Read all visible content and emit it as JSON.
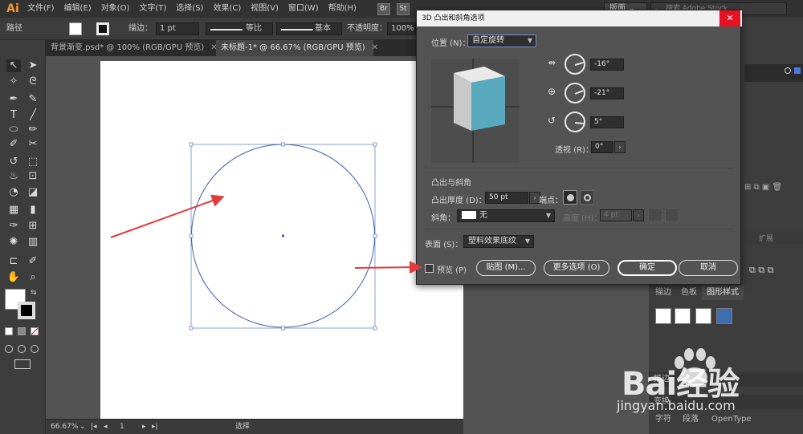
{
  "app": {
    "logo": "Ai"
  },
  "menubar": {
    "items": [
      "文件(F)",
      "编辑(E)",
      "对象(O)",
      "文字(T)",
      "选择(S)",
      "效果(C)",
      "视图(V)",
      "窗口(W)",
      "帮助(H)"
    ],
    "bridge_label": "Br",
    "stock_label": "St",
    "workspace": "版面",
    "search_placeholder": "搜索 Adobe Stock"
  },
  "controlbar": {
    "object_type": "路径",
    "stroke_label": "描边：",
    "stroke_weight": "1 pt",
    "profile_label": "等比",
    "brush_label": "基本",
    "opacity_label": "不透明度：",
    "opacity_value": "100%"
  },
  "tabs": [
    {
      "label": "背景渐变.psd* @ 100% (RGB/GPU 预览)",
      "close": "✕"
    },
    {
      "label": "未标题-1* @ 66.67% (RGB/GPU 预览)",
      "close": "✕"
    }
  ],
  "status": {
    "zoom": "66.67%",
    "page": "1",
    "tool": "选择"
  },
  "dialog": {
    "title": "3D 凸出和斜角选项",
    "position_label": "位置 (N)：",
    "position_value": "自定旋转",
    "rot_x": "-16°",
    "rot_y": "-21°",
    "rot_z": "5°",
    "perspective_label": "透视 (R)：",
    "perspective_value": "0°",
    "extrude_section": "凸出与斜角",
    "extrude_depth_label": "凸出厚度 (D)：",
    "extrude_depth_value": "50 pt",
    "cap_label": "端点：",
    "bevel_label": "斜角：",
    "bevel_value": "无",
    "height_label": "高度 (H)：",
    "height_value": "4 pt",
    "surface_label": "表面 (S)：",
    "surface_value": "塑料效果底纹",
    "preview_label": "预览 (P)",
    "map_button": "贴图 (M)...",
    "more_button": "更多选项 (O)",
    "ok_button": "确定",
    "cancel_button": "取消",
    "cube_colors": {
      "front": "#5aaabf",
      "top": "#e9e9e9",
      "side": "#c9c9c9"
    }
  },
  "panels": {
    "tabs": [
      "描边",
      "色板",
      "图形样式"
    ],
    "collapsed": [
      "描边",
      "变换",
      "字符",
      "段落",
      "OpenType"
    ],
    "expand_label": "扩展"
  },
  "watermark": {
    "brand": "Bai经验",
    "url": "jingyan.baidu.com"
  },
  "colors": {
    "accent": "#e03c3c",
    "path": "#3b5fb0"
  }
}
